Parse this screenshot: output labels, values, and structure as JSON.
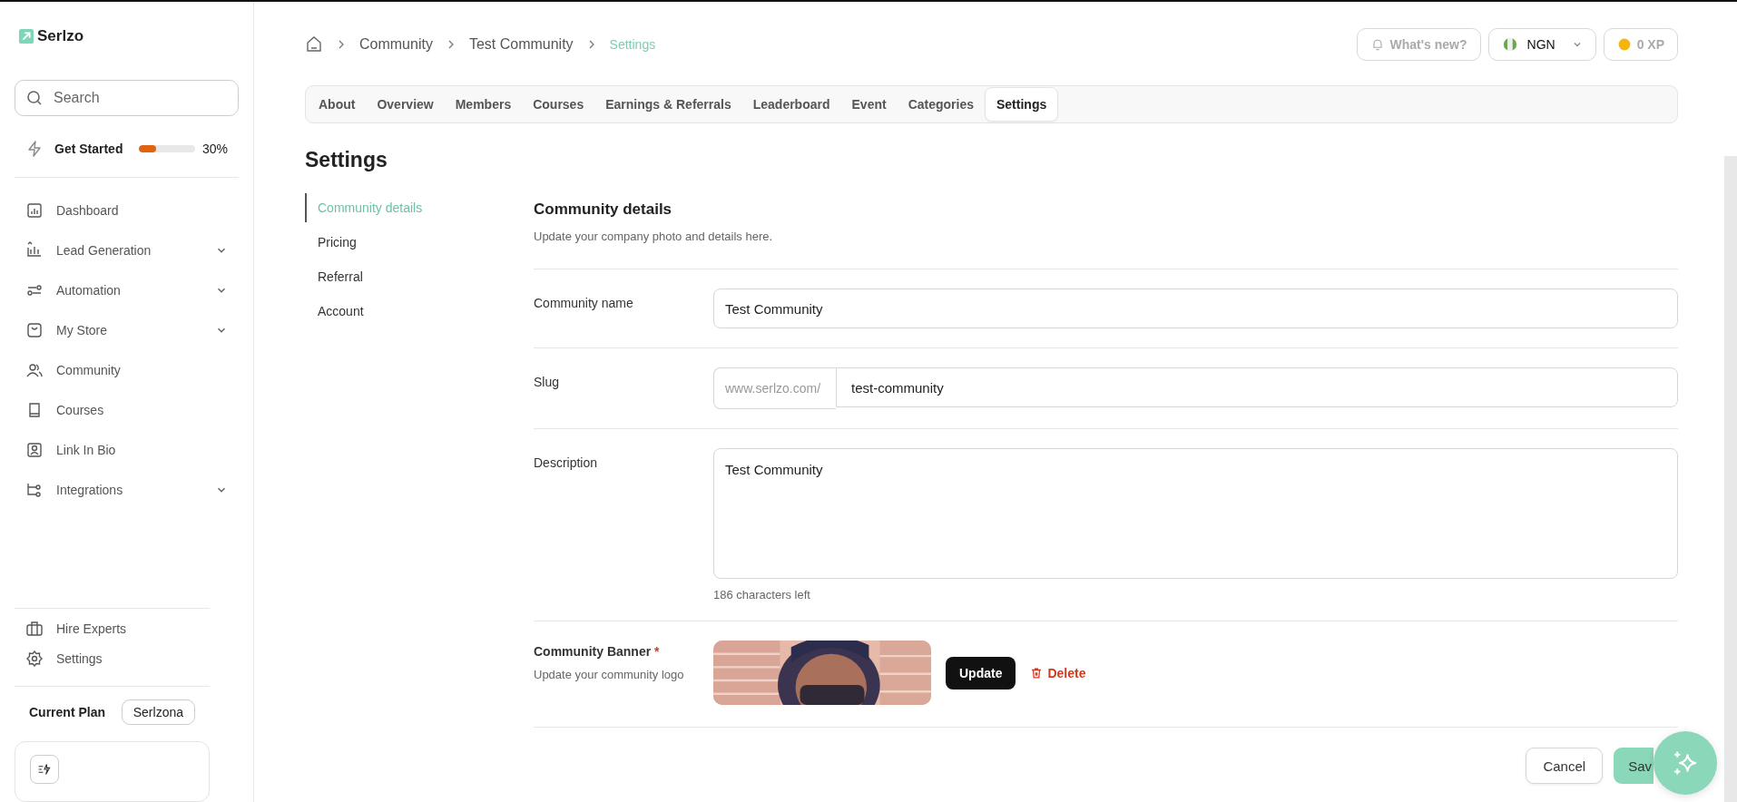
{
  "brand": {
    "name": "Serlzo"
  },
  "search": {
    "placeholder": "Search"
  },
  "get_started": {
    "label": "Get Started",
    "level": 0.3,
    "reading": "30%"
  },
  "nav": [
    {
      "label": "Dashboard",
      "expandable": false
    },
    {
      "label": "Lead Generation",
      "expandable": true
    },
    {
      "label": "Automation",
      "expandable": true
    },
    {
      "label": "My Store",
      "expandable": true
    },
    {
      "label": "Community",
      "expandable": false
    },
    {
      "label": "Courses",
      "expandable": false
    },
    {
      "label": "Link In Bio",
      "expandable": false
    },
    {
      "label": "Integrations",
      "expandable": true
    }
  ],
  "nav_bottom": [
    {
      "label": "Hire Experts"
    },
    {
      "label": "Settings"
    }
  ],
  "plan": {
    "label": "Current Plan",
    "value": "Serlzona"
  },
  "breadcrumb": [
    {
      "label": "Community",
      "current": false
    },
    {
      "label": "Test Community",
      "current": false
    },
    {
      "label": "Settings",
      "current": true
    }
  ],
  "topbar": {
    "whats_new": "What's new?",
    "currency": "NGN",
    "xp": "0 XP"
  },
  "tabs": [
    {
      "label": "About",
      "selected": false
    },
    {
      "label": "Overview",
      "selected": false
    },
    {
      "label": "Members",
      "selected": false
    },
    {
      "label": "Courses",
      "selected": false
    },
    {
      "label": "Earnings & Referrals",
      "selected": false
    },
    {
      "label": "Leaderboard",
      "selected": false
    },
    {
      "label": "Event",
      "selected": false
    },
    {
      "label": "Categories",
      "selected": false
    },
    {
      "label": "Settings",
      "selected": true
    }
  ],
  "page_title": "Settings",
  "subnav": [
    {
      "label": "Community details",
      "selected": true
    },
    {
      "label": "Pricing",
      "selected": false
    },
    {
      "label": "Referral",
      "selected": false
    },
    {
      "label": "Account",
      "selected": false
    }
  ],
  "section": {
    "title": "Community details",
    "subtitle": "Update your company photo and details here."
  },
  "fields": {
    "name_label": "Community name",
    "name_value": "Test Community",
    "slug_label": "Slug",
    "slug_prefix": "www.serlzo.com/",
    "slug_value": "test-community",
    "description_label": "Description",
    "description_value": "Test Community",
    "description_hint": "186 characters left"
  },
  "banner": {
    "label": "Community Banner",
    "required_mark": "*",
    "hint": "Update your community logo",
    "update": "Update",
    "delete": "Delete"
  },
  "actions": {
    "cancel": "Cancel",
    "save": "Sav"
  }
}
